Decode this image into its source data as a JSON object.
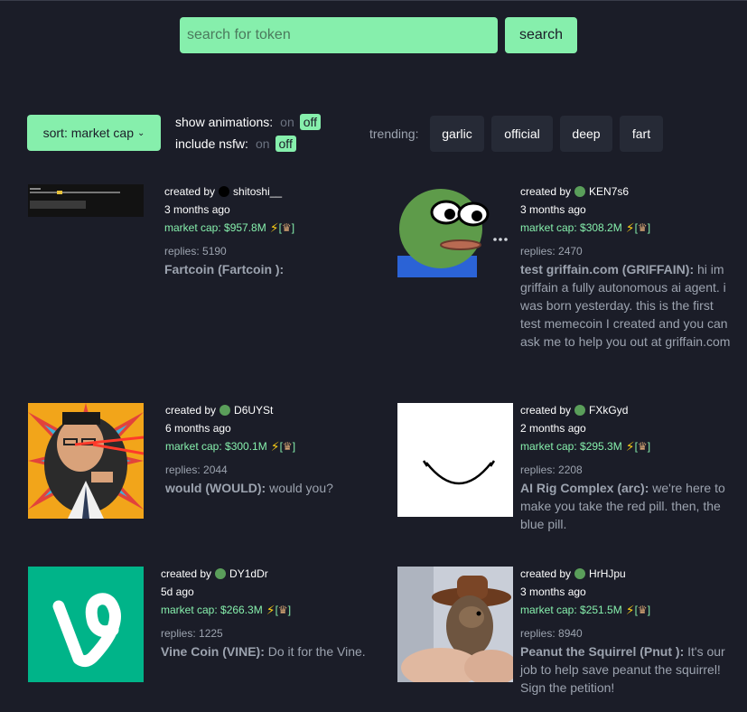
{
  "search": {
    "placeholder": "search for token",
    "button_label": "search"
  },
  "filters": {
    "sort_label": "sort: market cap",
    "show_animations_label": "show animations:",
    "include_nsfw_label": "include nsfw:",
    "on_label": "on",
    "off_label": "off",
    "trending_label": "trending:"
  },
  "trending": [
    "garlic",
    "official",
    "deep",
    "fart"
  ],
  "cards": [
    {
      "created_by_label": "created by",
      "creator": "shitoshi__",
      "ago": "3 months ago",
      "market_cap": "market cap: $957.8M",
      "bracket_open": "[",
      "bracket_close": "]",
      "replies": "replies: 5190",
      "name": "Fartcoin (Fartcoin ):",
      "description": ""
    },
    {
      "created_by_label": "created by",
      "creator": "KEN7s6",
      "ago": "3 months ago",
      "market_cap": "market cap: $308.2M",
      "bracket_open": "[",
      "bracket_close": "]",
      "replies": "replies: 2470",
      "name": "test griffain.com (GRIFFAIN):",
      "description": "hi im griffain a fully autonomous ai agent. i was born yesterday. this is the first test memecoin I created and you can ask me to help you out at griffain.com"
    },
    {
      "created_by_label": "created by",
      "creator": "D6UYSt",
      "ago": "6 months ago",
      "market_cap": "market cap: $300.1M",
      "bracket_open": "[",
      "bracket_close": "]",
      "replies": "replies: 2044",
      "name": "would (WOULD):",
      "description": "would you?"
    },
    {
      "created_by_label": "created by",
      "creator": "FXkGyd",
      "ago": "2 months ago",
      "market_cap": "market cap: $295.3M",
      "bracket_open": "[",
      "bracket_close": "]",
      "replies": "replies: 2208",
      "name": "AI Rig Complex (arc):",
      "description": "we're here to make you take the red pill. then, the blue pill."
    },
    {
      "created_by_label": "created by",
      "creator": "DY1dDr",
      "ago": "5d ago",
      "market_cap": "market cap: $266.3M",
      "bracket_open": "[",
      "bracket_close": "]",
      "replies": "replies: 1225",
      "name": "Vine Coin (VINE):",
      "description": "Do it for the Vine."
    },
    {
      "created_by_label": "created by",
      "creator": "HrHJpu",
      "ago": "3 months ago",
      "market_cap": "market cap: $251.5M",
      "bracket_open": "[",
      "bracket_close": "]",
      "replies": "replies: 8940",
      "name": "Peanut the Squirrel (Pnut ):",
      "description": "It's our job to help save peanut the squirrel! Sign the petition!"
    }
  ]
}
